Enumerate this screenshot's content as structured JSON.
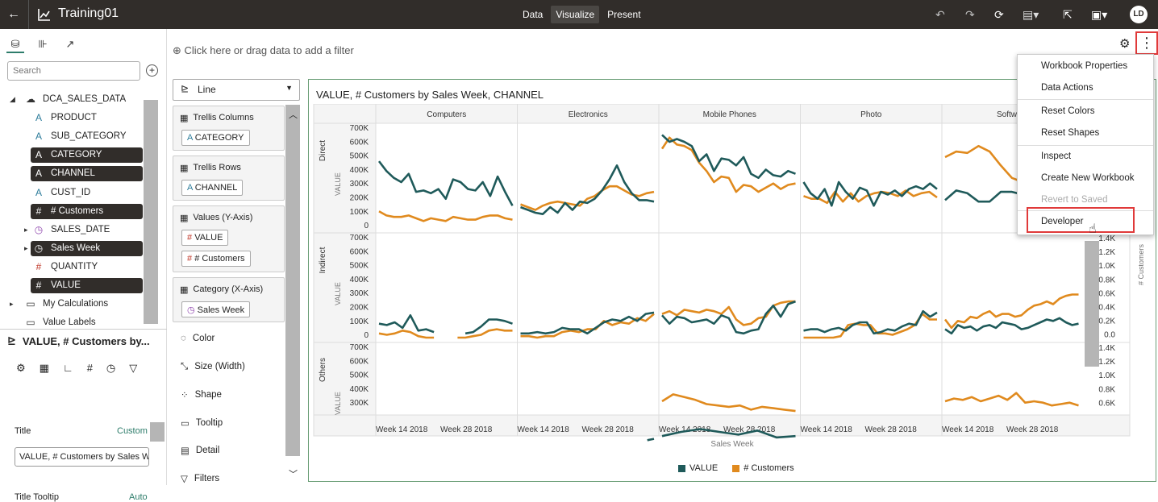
{
  "header": {
    "back": "←",
    "title": "Training01",
    "modes": [
      "Data",
      "Visualize",
      "Present"
    ],
    "active_mode": "Visualize",
    "avatar": "LD"
  },
  "left": {
    "search_placeholder": "Search",
    "tree": [
      {
        "label": "DCA_SALES_DATA",
        "icon": "☁",
        "indent": 1,
        "dark": false,
        "expander": "◢"
      },
      {
        "label": "PRODUCT",
        "icon": "A",
        "indent": 2,
        "dark": false
      },
      {
        "label": "SUB_CATEGORY",
        "icon": "A",
        "indent": 2,
        "dark": false
      },
      {
        "label": "CATEGORY",
        "icon": "A",
        "indent": 2,
        "dark": true
      },
      {
        "label": "CHANNEL",
        "icon": "A",
        "indent": 2,
        "dark": true
      },
      {
        "label": "CUST_ID",
        "icon": "A",
        "indent": 2,
        "dark": false
      },
      {
        "label": "# Customers",
        "icon": "#",
        "indent": 2,
        "dark": true
      },
      {
        "label": "SALES_DATE",
        "icon": "◷",
        "indent": 2,
        "dark": false,
        "expander": "▸"
      },
      {
        "label": "Sales Week",
        "icon": "◷",
        "indent": 2,
        "dark": true,
        "expander": "▸"
      },
      {
        "label": "QUANTITY",
        "icon": "#",
        "indent": 2,
        "dark": false
      },
      {
        "label": "VALUE",
        "icon": "#",
        "indent": 2,
        "dark": true
      },
      {
        "label": "My Calculations",
        "icon": "▭",
        "indent": 1,
        "dark": false,
        "expander": "▸"
      },
      {
        "label": "Value Labels",
        "icon": "▭",
        "indent": 1,
        "dark": false
      }
    ],
    "props_header": "VALUE, # Customers by...",
    "title_label": "Title",
    "title_mode": "Custom",
    "title_value": "VALUE, # Customers by Sales W",
    "tooltip_label": "Title Tooltip",
    "tooltip_mode": "Auto"
  },
  "filter_hint": "Click here or drag data to add a filter",
  "grammar": {
    "chart_type": "Line",
    "drops": [
      {
        "title": "Trellis Columns",
        "pills": [
          "CATEGORY"
        ]
      },
      {
        "title": "Trellis Rows",
        "pills": [
          "CHANNEL"
        ]
      },
      {
        "title": "Values (Y-Axis)",
        "pills": [
          "VALUE",
          "# Customers"
        ]
      },
      {
        "title": "Category (X-Axis)",
        "pills": [
          "Sales Week"
        ]
      }
    ],
    "props": [
      "Color",
      "Size (Width)",
      "Shape",
      "Tooltip",
      "Detail",
      "Filters"
    ]
  },
  "chart_data": {
    "type": "line",
    "title": "VALUE, # Customers by Sales Week, CHANNEL",
    "columns": [
      "Computers",
      "Electronics",
      "Mobile Phones",
      "Photo",
      "Software"
    ],
    "rows": [
      "Direct",
      "Indirect",
      "Others"
    ],
    "y_ticks": [
      "700K",
      "600K",
      "500K",
      "400K",
      "300K",
      "200K",
      "100K",
      "0"
    ],
    "y2_ticks": [
      "1.4K",
      "1.2K",
      "1.0K",
      "0.8K",
      "0.6K",
      "0.4K",
      "0.2K",
      "0.0"
    ],
    "y2_ticks_partial": [
      "1.4K",
      "1.2K",
      "1.0K",
      "0.8K",
      "0.6K"
    ],
    "ylabel": "VALUE",
    "y2label": "# Customers",
    "x_ticks": [
      "Week 14 2018",
      "Week 28 2018"
    ],
    "xlabel": "Sales Week",
    "series": [
      {
        "name": "VALUE",
        "color": "#1f5a5a"
      },
      {
        "name": "# Customers",
        "color": "#e08a1e"
      }
    ],
    "value_series": {
      "Direct": {
        "Computers": [
          450,
          380,
          330,
          300,
          360,
          230,
          240,
          220,
          250,
          180,
          320,
          300,
          250,
          240,
          300,
          200,
          340,
          230,
          130
        ],
        "Electronics": [
          120,
          100,
          80,
          70,
          120,
          80,
          150,
          100,
          160,
          150,
          180,
          240,
          320,
          420,
          300,
          220,
          170,
          170,
          160
        ],
        "Mobile Phones": [
          640,
          590,
          610,
          590,
          560,
          450,
          500,
          380,
          470,
          460,
          420,
          480,
          360,
          330,
          390,
          350,
          340,
          380,
          360
        ],
        "Photo": [
          300,
          220,
          180,
          250,
          130,
          300,
          230,
          180,
          260,
          240,
          130,
          230,
          210,
          240,
          200,
          250,
          270,
          250,
          290,
          250
        ],
        "Software": [
          170,
          240,
          220,
          160,
          160,
          230,
          230,
          210,
          160,
          160,
          230,
          180,
          240
        ]
      },
      "Indirect": {
        "Computers": [
          70,
          60,
          80,
          40,
          130,
          20,
          30,
          10,
          null,
          null,
          null,
          0,
          10,
          50,
          100,
          100,
          90,
          70
        ],
        "Electronics": [
          0,
          0,
          10,
          0,
          10,
          40,
          30,
          30,
          0,
          40,
          80,
          100,
          90,
          120,
          90,
          140,
          150
        ],
        "Mobile Phones": [
          130,
          70,
          120,
          110,
          80,
          90,
          100,
          70,
          130,
          110,
          10,
          0,
          20,
          30,
          140,
          200,
          120,
          210,
          230
        ],
        "Photo": [
          20,
          30,
          30,
          10,
          30,
          40,
          20,
          60,
          80,
          80,
          0,
          10,
          30,
          20,
          50,
          70,
          60,
          160,
          120,
          150
        ],
        "Software": [
          30,
          0,
          60,
          40,
          50,
          20,
          50,
          60,
          40,
          80,
          70,
          60,
          30,
          40,
          60,
          80,
          100,
          90,
          110,
          80,
          60,
          70
        ]
      },
      "Others": {
        "Electronics": [
          null,
          null,
          null,
          null,
          null,
          null,
          null,
          null,
          null,
          null,
          null,
          null,
          null,
          null,
          null,
          null,
          null,
          null,
          null,
          20,
          30
        ],
        "Mobile Phones": [
          50,
          80,
          100,
          80,
          60,
          90,
          40,
          50
        ]
      }
    },
    "customer_series": {
      "Direct": {
        "Computers": [
          90,
          60,
          50,
          50,
          60,
          40,
          20,
          40,
          30,
          20,
          50,
          40,
          30,
          30,
          50,
          60,
          60,
          40,
          30
        ],
        "Electronics": [
          140,
          120,
          100,
          130,
          150,
          160,
          150,
          140,
          130,
          180,
          200,
          240,
          270,
          270,
          240,
          210,
          200,
          220,
          230
        ],
        "Mobile Phones": [
          540,
          620,
          570,
          560,
          530,
          440,
          380,
          300,
          340,
          330,
          230,
          280,
          270,
          230,
          260,
          290,
          250,
          280,
          290
        ],
        "Photo": [
          200,
          180,
          180,
          150,
          230,
          160,
          220,
          160,
          200,
          220,
          230,
          220,
          200,
          240,
          200,
          220,
          230,
          190
        ],
        "Software": [
          480,
          520,
          510,
          560,
          520,
          420,
          330,
          300,
          340,
          380,
          350,
          330,
          320
        ]
      },
      "Indirect": {
        "Computers": [
          0,
          -10,
          0,
          20,
          10,
          -20,
          -30,
          -30,
          null,
          null,
          -40,
          -30,
          -20,
          -10,
          20,
          30,
          20,
          20
        ],
        "Electronics": [
          -20,
          -20,
          -30,
          -20,
          -20,
          10,
          20,
          10,
          30,
          30,
          90,
          60,
          80,
          70,
          110,
          90,
          140
        ],
        "Mobile Phones": [
          140,
          160,
          130,
          170,
          160,
          150,
          170,
          160,
          140,
          190,
          100,
          60,
          70,
          110,
          120,
          200,
          220,
          230,
          230
        ],
        "Photo": [
          -30,
          -30,
          -30,
          -40,
          -30,
          -20,
          60,
          70,
          60,
          60,
          0,
          0,
          -10,
          10,
          30,
          60,
          140,
          100,
          100
        ],
        "Software": [
          100,
          40,
          90,
          80,
          120,
          110,
          140,
          160,
          120,
          140,
          140,
          120,
          130,
          170,
          200,
          210,
          230,
          210,
          250,
          270,
          280,
          280
        ]
      },
      "Others": {
        "Mobile Phones": [
          300,
          350,
          330,
          310,
          280,
          270,
          260,
          270,
          240,
          260,
          250,
          240,
          230
        ],
        "Software": [
          300,
          320,
          310,
          330,
          300,
          320,
          340,
          310,
          360,
          290,
          300,
          290,
          270,
          280,
          290,
          270
        ]
      }
    }
  },
  "menu": {
    "items": [
      "Workbook Properties",
      "Data Actions",
      "Reset Colors",
      "Reset Shapes",
      "Inspect",
      "Create New Workbook",
      "Revert to Saved",
      "Developer"
    ],
    "disabled": [
      "Revert to Saved"
    ]
  }
}
